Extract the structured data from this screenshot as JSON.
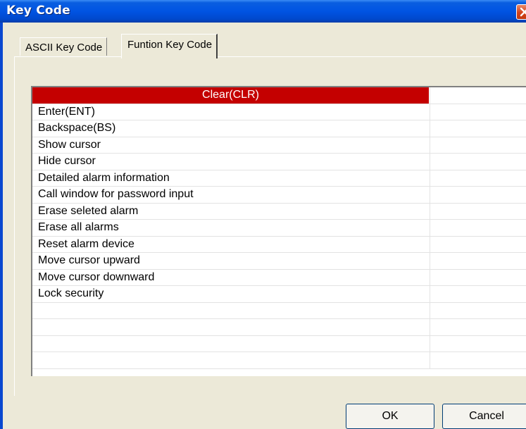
{
  "window": {
    "title": "Key Code"
  },
  "tabs": [
    {
      "label": "ASCII Key Code"
    },
    {
      "label": "Funtion Key Code"
    }
  ],
  "list": {
    "items": [
      {
        "label": "Clear(CLR)"
      },
      {
        "label": "Enter(ENT)"
      },
      {
        "label": "Backspace(BS)"
      },
      {
        "label": "Show cursor"
      },
      {
        "label": "Hide cursor"
      },
      {
        "label": "Detailed alarm information"
      },
      {
        "label": "Call window for password input"
      },
      {
        "label": "Erase seleted alarm"
      },
      {
        "label": "Erase all alarms"
      },
      {
        "label": "Reset alarm device"
      },
      {
        "label": "Move cursor upward"
      },
      {
        "label": "Move cursor downward"
      },
      {
        "label": "Lock security"
      },
      {
        "label": ""
      },
      {
        "label": ""
      },
      {
        "label": ""
      },
      {
        "label": ""
      }
    ]
  },
  "buttons": {
    "ok": "OK",
    "cancel": "Cancel"
  },
  "colors": {
    "selection": "#c40000",
    "titlebar": "#0054e3"
  }
}
